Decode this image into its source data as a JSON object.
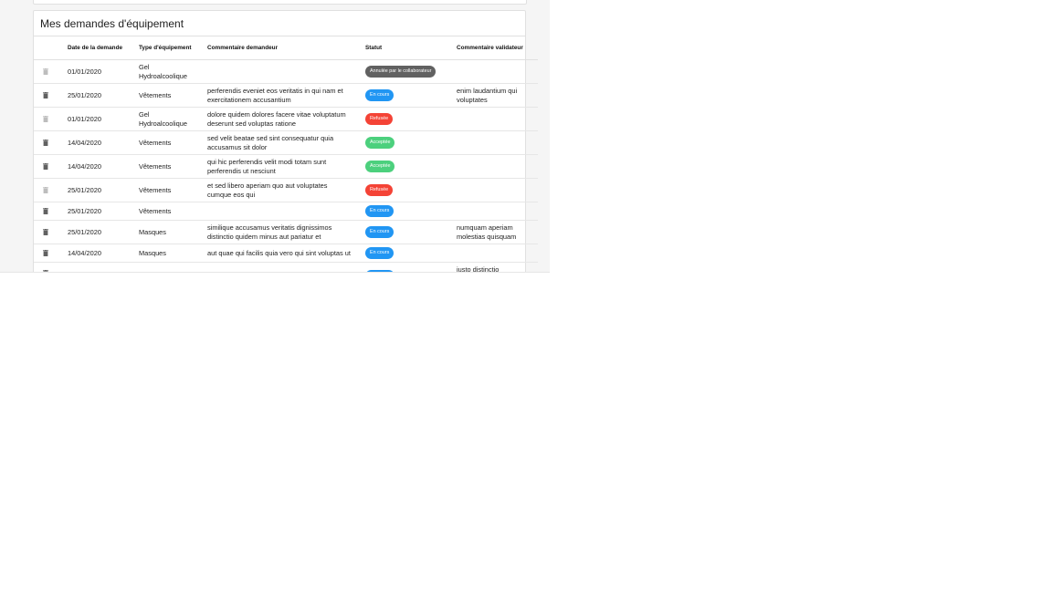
{
  "card": {
    "title": "Mes demandes d'équipement"
  },
  "table": {
    "headers": [
      "",
      "Date de la demande",
      "Type d'équipement",
      "Commentaire demandeur",
      "Statut",
      "Commentaire validateur"
    ],
    "rows": [
      {
        "icon": "trash-icon",
        "icon_color": "#bdbdbd",
        "date": "01/01/2020",
        "type": "Gel Hydroalcoolique",
        "comment": "",
        "status": "Annulée par le collaborateur",
        "status_color": "#616161",
        "validator": ""
      },
      {
        "icon": "trash-icon",
        "icon_color": "#616161",
        "date": "25/01/2020",
        "type": "Vêtements",
        "comment": "perferendis eveniet eos veritatis in qui nam et exercitationem accusantium",
        "status": "En cours",
        "status_color": "#2196f3",
        "validator": "enim laudantium qui voluptates"
      },
      {
        "icon": "trash-icon",
        "icon_color": "#bdbdbd",
        "date": "01/01/2020",
        "type": "Gel Hydroalcoolique",
        "comment": "dolore quidem dolores facere vitae voluptatum deserunt sed voluptas ratione",
        "status": "Refusée",
        "status_color": "#f44336",
        "validator": ""
      },
      {
        "icon": "trash-icon",
        "icon_color": "#616161",
        "date": "14/04/2020",
        "type": "Vêtements",
        "comment": "sed velit beatae sed sint consequatur quia accusamus sit dolor",
        "status": "Acceptée",
        "status_color": "#4cd07d",
        "validator": ""
      },
      {
        "icon": "trash-icon",
        "icon_color": "#616161",
        "date": "14/04/2020",
        "type": "Vêtements",
        "comment": "qui hic perferendis velit modi totam sunt perferendis ut nesciunt",
        "status": "Acceptée",
        "status_color": "#4cd07d",
        "validator": ""
      },
      {
        "icon": "trash-icon",
        "icon_color": "#bdbdbd",
        "date": "25/01/2020",
        "type": "Vêtements",
        "comment": "et sed libero aperiam quo aut voluptates cumque eos qui",
        "status": "Refusée",
        "status_color": "#f44336",
        "validator": ""
      },
      {
        "icon": "trash-icon",
        "icon_color": "#616161",
        "date": "25/01/2020",
        "type": "Vêtements",
        "comment": "",
        "status": "En cours",
        "status_color": "#2196f3",
        "validator": ""
      },
      {
        "icon": "trash-icon",
        "icon_color": "#616161",
        "date": "25/01/2020",
        "type": "Masques",
        "comment": "similique accusamus veritatis dignissimos distinctio quidem minus aut pariatur et",
        "status": "En cours",
        "status_color": "#2196f3",
        "validator": "numquam aperiam molestias quisquam"
      },
      {
        "icon": "trash-icon",
        "icon_color": "#616161",
        "date": "14/04/2020",
        "type": "Masques",
        "comment": "aut quae qui facilis quia vero qui sint voluptas ut",
        "status": "En cours",
        "status_color": "#2196f3",
        "validator": ""
      },
      {
        "icon": "trash-icon",
        "icon_color": "#616161",
        "date": "",
        "type": "",
        "comment": "",
        "status": "",
        "status_color": "#2196f3",
        "validator": "iusto distinctio asperiores"
      }
    ]
  }
}
